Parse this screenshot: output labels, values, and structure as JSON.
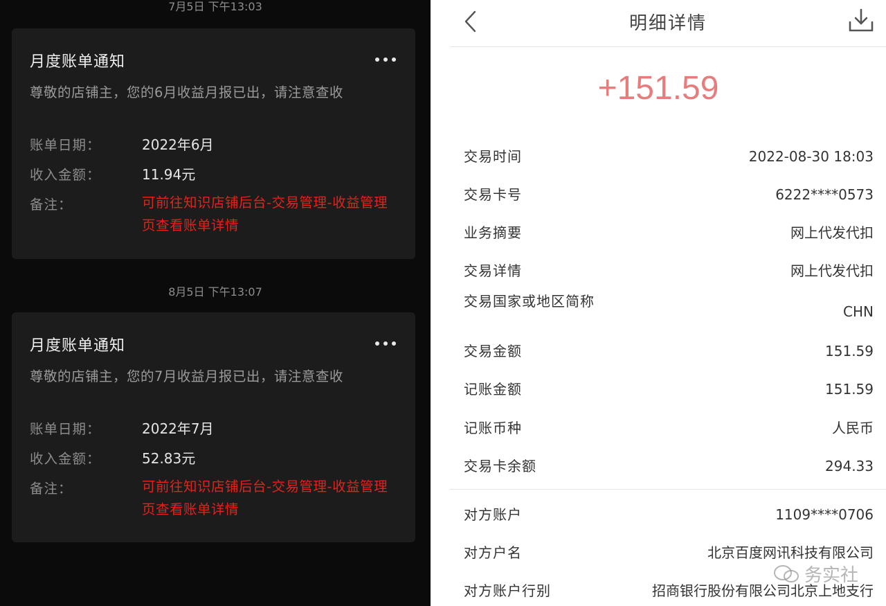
{
  "left": {
    "messages": [
      {
        "timestamp": "7月5日 下午13:03",
        "title": "月度账单通知",
        "intro": "尊敬的店铺主，您的6月收益月报已出，请注意查收",
        "fields": {
          "date_label": "账单日期：",
          "date_value": "2022年6月",
          "income_label": "收入金额：",
          "income_value": "11.94元",
          "note_label": "备注：",
          "note_value": "可前往知识店铺后台-交易管理-收益管理页查看账单详情"
        }
      },
      {
        "timestamp": "8月5日 下午13:07",
        "title": "月度账单通知",
        "intro": "尊敬的店铺主，您的7月收益月报已出，请注意查收",
        "fields": {
          "date_label": "账单日期：",
          "date_value": "2022年7月",
          "income_label": "收入金额：",
          "income_value": "52.83元",
          "note_label": "备注：",
          "note_value": "可前往知识店铺后台-交易管理-收益管理页查看账单详情"
        }
      }
    ]
  },
  "right": {
    "header": {
      "title": "明细详情",
      "back_icon": "chevron-left-icon",
      "download_icon": "download-icon"
    },
    "amount": "+151.59",
    "details": [
      {
        "label": "交易时间",
        "value": "2022-08-30 18:03"
      },
      {
        "label": "交易卡号",
        "value": "6222****0573"
      },
      {
        "label": "业务摘要",
        "value": "网上代发代扣"
      },
      {
        "label": "交易详情",
        "value": "网上代发代扣"
      },
      {
        "label": "交易国家或地区简称",
        "value": "CHN"
      },
      {
        "label": "交易金额",
        "value": "151.59"
      },
      {
        "label": "记账金额",
        "value": "151.59"
      },
      {
        "label": "记账币种",
        "value": "人民币"
      },
      {
        "label": "交易卡余额",
        "value": "294.33"
      }
    ],
    "counterparty": [
      {
        "label": "对方账户",
        "value": "1109****0706"
      },
      {
        "label": "对方户名",
        "value": "北京百度网讯科技有限公司"
      },
      {
        "label": "对方账户行别",
        "value": "招商银行股份有限公司北京上地支行"
      }
    ],
    "watermark": "务实社"
  },
  "colors": {
    "dark_bg": "#0b0b0b",
    "card_bg": "#1c1c1c",
    "note_red": "#e3221c",
    "amount_pink": "#e57d7d"
  }
}
